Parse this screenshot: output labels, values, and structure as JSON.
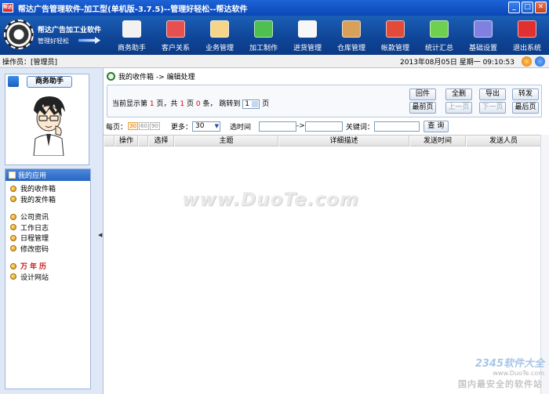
{
  "window": {
    "title": "帮达广告管理软件-加工型(单机版-3.7.5)--管理好轻松--帮达软件",
    "icon_text": "帮达"
  },
  "brand": {
    "name": "帮达广告加工业软件",
    "slogan": "管理好轻松"
  },
  "toolbar": {
    "items": [
      {
        "label": "商务助手",
        "icon": "pen-paper-icon",
        "color": "#f2f2f2"
      },
      {
        "label": "客户关系",
        "icon": "users-icon",
        "color": "#e85050"
      },
      {
        "label": "业务管理",
        "icon": "clipboard-icon",
        "color": "#f4d58a"
      },
      {
        "label": "加工制作",
        "icon": "cubes-icon",
        "color": "#4fbf4f"
      },
      {
        "label": "进货管理",
        "icon": "pencil-doc-icon",
        "color": "#f7f7f7"
      },
      {
        "label": "仓库管理",
        "icon": "warehouse-grid-icon",
        "color": "#d9a05a"
      },
      {
        "label": "帐款管理",
        "icon": "money-transfer-icon",
        "color": "#e24b3a"
      },
      {
        "label": "统计汇总",
        "icon": "chart-icon",
        "color": "#6fcf4f"
      },
      {
        "label": "基础设置",
        "icon": "settings-book-icon",
        "color": "#8080e0"
      },
      {
        "label": "退出系统",
        "icon": "exit-icon",
        "color": "#e03030"
      }
    ]
  },
  "status": {
    "operator": "操作员：[管理员]",
    "datetime": "2013年08月05日  星期一  09:10:53"
  },
  "assistant": {
    "title": "商务助手"
  },
  "apps": {
    "header": "我的应用",
    "items": [
      {
        "label": "我的收件箱"
      },
      {
        "label": "我的发件箱"
      },
      {
        "label": ""
      },
      {
        "label": "公司资讯"
      },
      {
        "label": "工作日志"
      },
      {
        "label": "日程管理"
      },
      {
        "label": "修改密码"
      },
      {
        "label": ""
      },
      {
        "label": "万年历",
        "red": true
      },
      {
        "label": "设计网站"
      }
    ]
  },
  "breadcrumb": {
    "text": "我的收件箱  ->  编辑处理"
  },
  "pager": {
    "prefix": "当前显示第",
    "page": "1",
    "mid1": "页，共",
    "total_pages": "1",
    "mid2": "页",
    "count": "0",
    "suffix": "条，  跳转到",
    "jump_value": "1",
    "end": "页",
    "buttons": {
      "reply": "回件",
      "delete": "全删",
      "export": "导出",
      "forward": "转发",
      "first": "最前页",
      "prev": "上一页",
      "next": "下一页",
      "last": "最后页"
    }
  },
  "filters": {
    "per_page_label": "每页：",
    "per_page_options": [
      "30",
      "60",
      "90"
    ],
    "more_label": "更多：",
    "more_value": "30",
    "time_label": "选时间",
    "range_sep": "->",
    "keyword_label": "关键词：",
    "search_label": "查 询"
  },
  "table": {
    "columns": [
      "操作",
      "选择",
      "主题",
      "详细描述",
      "发送时间",
      "发送人员"
    ]
  },
  "watermark": {
    "main": "www.DuoTe.com",
    "corner_logo": "2345软件大全",
    "corner_url": "www.DuoTe.com",
    "slogan": "国内最安全的软件站"
  }
}
